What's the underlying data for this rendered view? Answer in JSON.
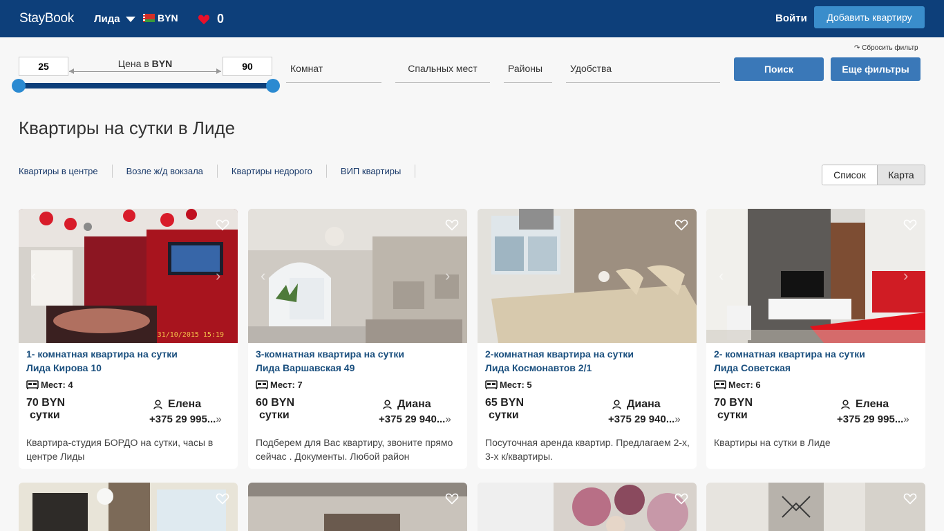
{
  "header": {
    "logo": "StayBook",
    "city": "Лида",
    "currency": "BYN",
    "favorites_count": "0",
    "login": "Войти",
    "add_apartment": "Добавить квартиру"
  },
  "filters": {
    "reset": "↷ Сбросить фильтр",
    "price_min": "25",
    "price_max": "90",
    "price_label": "Цена в",
    "price_currency": "BYN",
    "rooms": "Комнат",
    "sleeping_places": "Спальных мест",
    "districts": "Районы",
    "amenities": "Удобства",
    "search": "Поиск",
    "more_filters": "Еще фильтры"
  },
  "page_title": "Квартиры на сутки в Лиде",
  "quick_links": [
    "Квартиры в центре",
    "Возле ж/д вокзала",
    "Квартиры недорого",
    "ВИП квартиры"
  ],
  "view_toggle": {
    "list": "Список",
    "map": "Карта"
  },
  "listings": [
    {
      "title_line1": "1- комнатная квартира на сутки",
      "title_line2": "Лида Кирова 10",
      "places": "Мест: 4",
      "price": "70 BYN",
      "period": "сутки",
      "owner": "Елена",
      "phone": "+375 29 995...",
      "description": "Квартира-студия БОРДО на сутки, часы в центре Лиды",
      "photo_timestamp": "31/10/2015 15:19"
    },
    {
      "title_line1": "3-комнатная квартира на сутки",
      "title_line2": "Лида Варшавская 49",
      "places": "Мест: 7",
      "price": "60 BYN",
      "period": "сутки",
      "owner": "Диана",
      "phone": "+375 29 940...",
      "description": "Подберем для Вас квартиру, звоните прямо сейчас . Документы. Любой район"
    },
    {
      "title_line1": "2-комнатная квартира на сутки",
      "title_line2": "Лида Космонавтов 2/1",
      "places": "Мест: 5",
      "price": "65 BYN",
      "period": "сутки",
      "owner": "Диана",
      "phone": "+375 29 940...",
      "description": "Посуточная аренда квартир. Предлагаем 2-х, 3-х к/квартиры."
    },
    {
      "title_line1": "2- комнатная квартира на сутки",
      "title_line2": "Лида Советская",
      "places": "Мест: 6",
      "price": "70 BYN",
      "period": "сутки",
      "owner": "Елена",
      "phone": "+375 29 995...",
      "description": "Квартиры на сутки в Лиде"
    }
  ],
  "colors": {
    "header_bg": "#0d3f7a",
    "accent_button": "#3a8dcb",
    "primary_button": "#3a78b8",
    "link": "#1a4f7e",
    "heart": "#e8102a"
  },
  "icons": {
    "favorites": "heart-icon",
    "city_dropdown": "chevron-down-icon",
    "currency": "belarus-flag-icon",
    "card_favorite": "heart-outline-icon",
    "places": "bed-icon",
    "owner": "user-icon",
    "phone_more": "double-chevron-right-icon"
  }
}
